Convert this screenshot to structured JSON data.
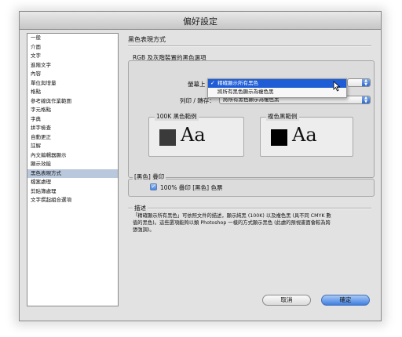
{
  "window": {
    "title": "偏好設定"
  },
  "sidebar": {
    "items": [
      "一般",
      "介面",
      "文字",
      "進階文字",
      "內容",
      "單位與增量",
      "格點",
      "參考線與作業範圍",
      "字元格點",
      "字典",
      "拼字檢查",
      "自動更正",
      "註解",
      "內文編輯器顯示",
      "顯示效能",
      "黑色表現方式",
      "檔案處理",
      "剪貼簿處理",
      "文字撰起組合選項"
    ],
    "selected_index": 15
  },
  "main": {
    "title": "黑色表現方式",
    "rgb_group": {
      "label": "RGB 及灰階裝置的黑色選項",
      "screen_label": "螢幕上",
      "print_label": "列印 / 轉存：",
      "print_value": "將所有黑色顯示為複色黑",
      "dropdown_options": [
        {
          "label": "精確顯示所有黑色",
          "checked": true,
          "highlighted": true
        },
        {
          "label": "將所有黑色顯示為複色黑",
          "checked": false,
          "highlighted": false
        }
      ]
    },
    "sample_100k": {
      "label": "100K 黑色範例",
      "text": "Aa",
      "swatch_color": "#3a3a3a"
    },
    "sample_rich": {
      "label": "複色黑範例",
      "text": "Aa",
      "swatch_color": "#000000"
    },
    "overprint_group": {
      "label": "[黑色] 疊印",
      "checkbox_label": "100% 疊印 [黑色] 色票",
      "checked": true
    },
    "description": {
      "label": "描述",
      "line1": "「精確顯示所有黑色」可依照文件的描述，顯示純黑 (100K) 以及複色黑 (具不同 CMYK 數",
      "line2": "值的黑色)。這些選項能夠以類 Photoshop 一樣的方式顯示黑色 (此處的預視畫面會較為跨",
      "line3": "張強調)。"
    }
  },
  "buttons": {
    "cancel": "取消",
    "ok": "確定"
  },
  "colors": {
    "accent": "#2c6ad0",
    "selection": "#b9c8dd",
    "menu_highlight": "#1f5dd6"
  }
}
